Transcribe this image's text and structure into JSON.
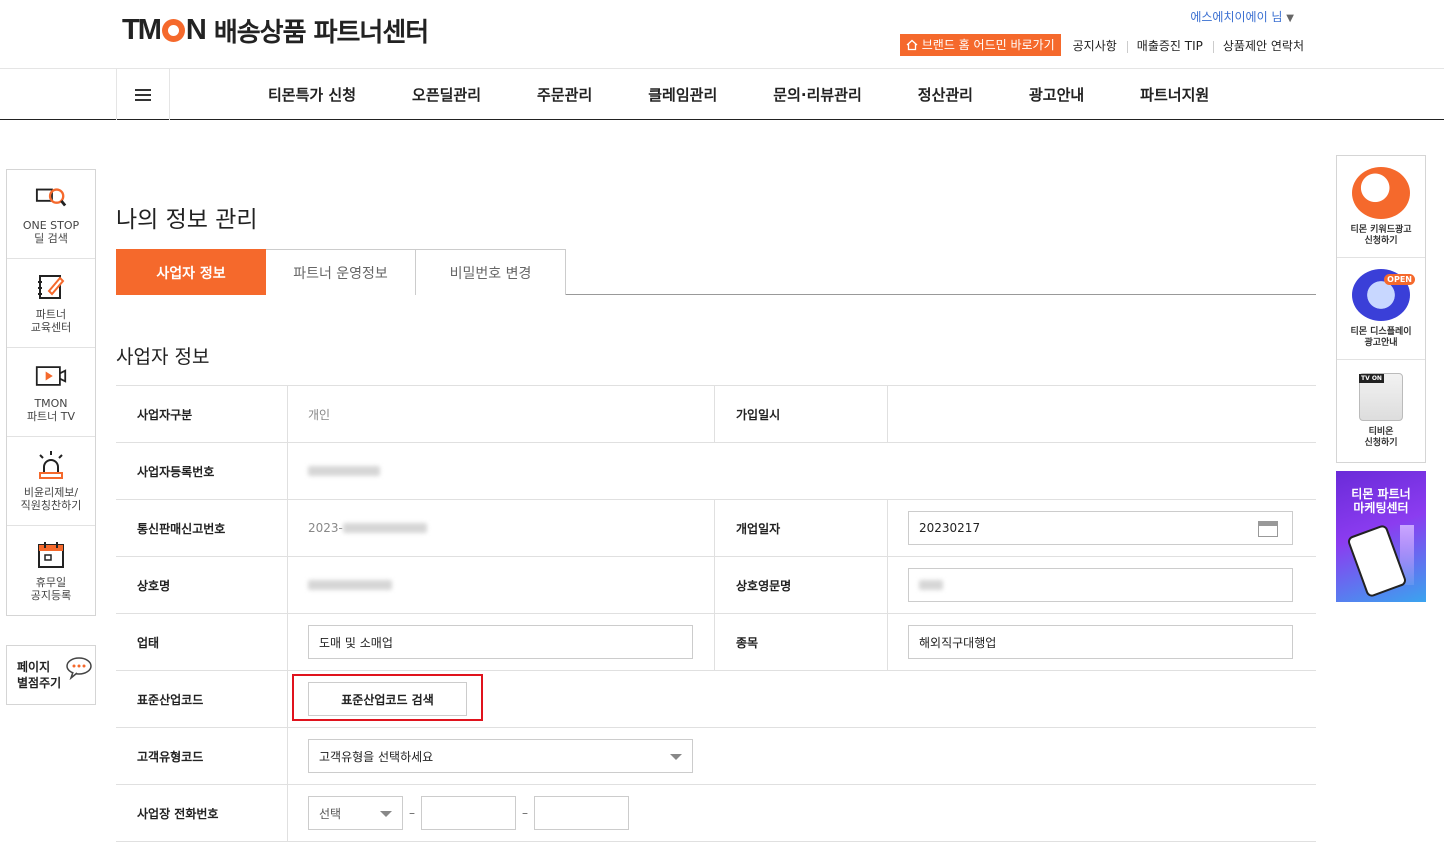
{
  "header": {
    "logo_text": "TMON",
    "title": "배송상품 파트너센터",
    "user_name": "에스에치이에이 님",
    "brand_button": "브랜드 홈 어드민 바로가기",
    "links": [
      "공지사항",
      "매출증진 TIP",
      "상품제안 연락처"
    ]
  },
  "nav": {
    "items": [
      "티몬특가 신청",
      "오픈딜관리",
      "주문관리",
      "클레임관리",
      "문의·리뷰관리",
      "정산관리",
      "광고안내",
      "파트너지원"
    ]
  },
  "left_sidebar": {
    "items": [
      {
        "label": "ONE STOP\n딜 검색",
        "icon": "search-deal-icon"
      },
      {
        "label": "파트너\n교육센터",
        "icon": "edit-note-icon"
      },
      {
        "label": "TMON\n파트너 TV",
        "icon": "video-play-icon"
      },
      {
        "label": "비윤리제보/\n직원칭찬하기",
        "icon": "alarm-light-icon"
      },
      {
        "label": "휴무일\n공지등록",
        "icon": "calendar-icon"
      }
    ],
    "bookmark": "페이지\n별점주기"
  },
  "right_sidebar": {
    "items": [
      {
        "label": "티몬 키워드광고\n신청하기"
      },
      {
        "label": "티몬 디스플레이\n광고안내",
        "badge": "OPEN"
      },
      {
        "label": "티비온\n신청하기",
        "badge": "TV ON"
      }
    ],
    "banner_title": "티몬 파트너\n마케팅센터",
    "colors": {
      "banner_start": "#6a2bd8",
      "banner_end": "#3aa4ef"
    }
  },
  "main": {
    "page_title": "나의 정보 관리",
    "tabs": [
      "사업자 정보",
      "파트너 운영정보",
      "비밀번호 변경"
    ],
    "active_tab": "사업자 정보",
    "section_title": "사업자 정보"
  },
  "form": {
    "business_type_label": "사업자구분",
    "business_type_value": "개인",
    "join_date_label": "가입일시",
    "join_date_value": "",
    "reg_number_label": "사업자등록번호",
    "ecommerce_label": "통신판매신고번호",
    "ecommerce_prefix": "2023-",
    "open_date_label": "개업일자",
    "open_date_value": "20230217",
    "company_label": "상호명",
    "company_en_label": "상호영문명",
    "industry_label": "업태",
    "industry_value": "도매 및 소매업",
    "category_label": "종목",
    "category_value": "해외직구대행업",
    "std_code_label": "표준산업코드",
    "std_code_button": "표준산업코드 검색",
    "customer_type_label": "고객유형코드",
    "customer_type_value": "고객유형을 선택하세요",
    "phone_label": "사업장 전화번호",
    "phone_select": "선택",
    "phone_separator": "–"
  },
  "colors": {
    "accent": "#f5692c",
    "highlight": "#e0131d",
    "link_blue": "#3a6fd1"
  }
}
